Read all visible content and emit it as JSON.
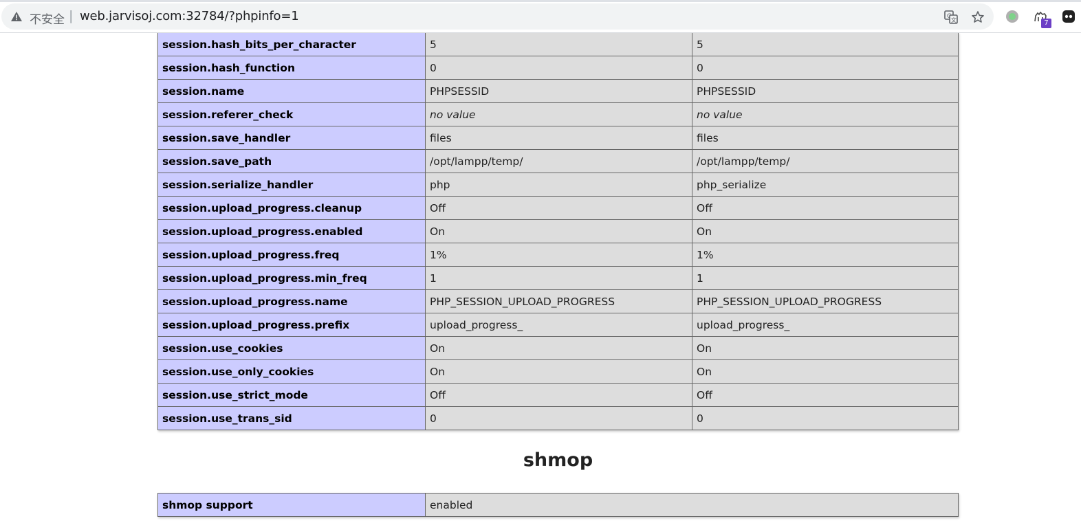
{
  "browser": {
    "security_label": "不安全",
    "separator": "|",
    "url": "web.jarvisoj.com:32784/?phpinfo=1",
    "extension_badge": "7",
    "icons": [
      "warning-icon",
      "translate-icon",
      "star-icon",
      "extension-circle-icon",
      "extension-camel-icon",
      "extension-dots-icon"
    ]
  },
  "session_rows": [
    {
      "directive": "session.hash_bits_per_character",
      "local": "5",
      "master": "5"
    },
    {
      "directive": "session.hash_function",
      "local": "0",
      "master": "0"
    },
    {
      "directive": "session.name",
      "local": "PHPSESSID",
      "master": "PHPSESSID"
    },
    {
      "directive": "session.referer_check",
      "local": "no value",
      "master": "no value",
      "novalue": true
    },
    {
      "directive": "session.save_handler",
      "local": "files",
      "master": "files"
    },
    {
      "directive": "session.save_path",
      "local": "/opt/lampp/temp/",
      "master": "/opt/lampp/temp/"
    },
    {
      "directive": "session.serialize_handler",
      "local": "php",
      "master": "php_serialize"
    },
    {
      "directive": "session.upload_progress.cleanup",
      "local": "Off",
      "master": "Off"
    },
    {
      "directive": "session.upload_progress.enabled",
      "local": "On",
      "master": "On"
    },
    {
      "directive": "session.upload_progress.freq",
      "local": "1%",
      "master": "1%"
    },
    {
      "directive": "session.upload_progress.min_freq",
      "local": "1",
      "master": "1"
    },
    {
      "directive": "session.upload_progress.name",
      "local": "PHP_SESSION_UPLOAD_PROGRESS",
      "master": "PHP_SESSION_UPLOAD_PROGRESS"
    },
    {
      "directive": "session.upload_progress.prefix",
      "local": "upload_progress_",
      "master": "upload_progress_"
    },
    {
      "directive": "session.use_cookies",
      "local": "On",
      "master": "On"
    },
    {
      "directive": "session.use_only_cookies",
      "local": "On",
      "master": "On"
    },
    {
      "directive": "session.use_strict_mode",
      "local": "Off",
      "master": "Off"
    },
    {
      "directive": "session.use_trans_sid",
      "local": "0",
      "master": "0"
    }
  ],
  "shmop": {
    "title": "shmop",
    "rows": [
      {
        "directive": "shmop support",
        "value": "enabled"
      }
    ]
  },
  "colors": {
    "directive_bg": "#ccccff",
    "value_bg": "#dddddd",
    "border": "#666666",
    "novalue": "#999999"
  }
}
